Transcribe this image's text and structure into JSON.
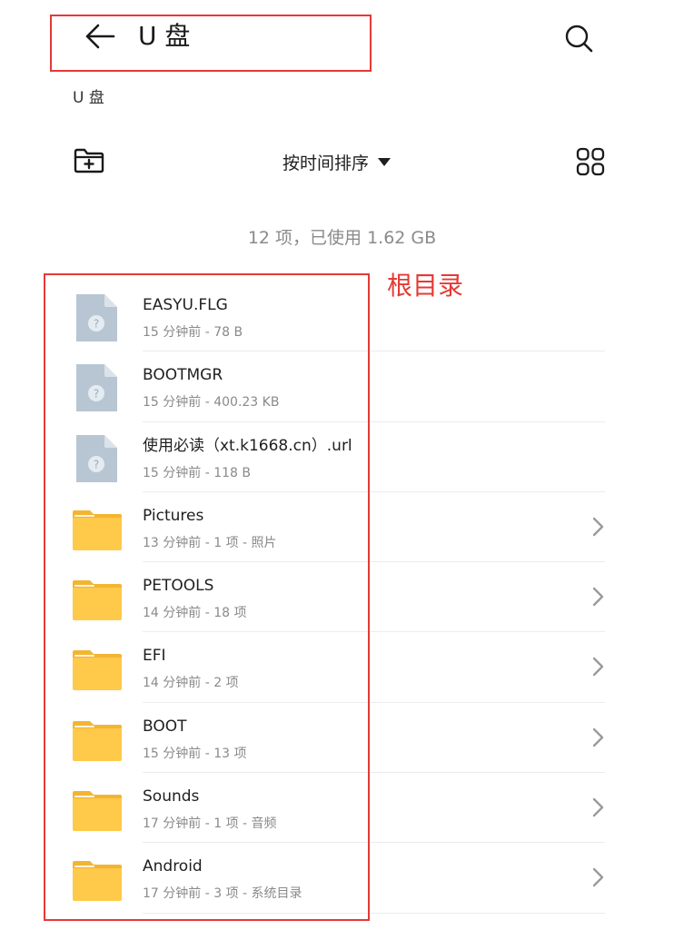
{
  "header": {
    "title": "U 盘",
    "back_icon": "arrow-left-icon",
    "search_icon": "search-icon"
  },
  "breadcrumb": "U 盘",
  "toolbar": {
    "new_folder_icon": "new-folder-icon",
    "sort_label": "按时间排序",
    "view_icon": "grid-view-icon"
  },
  "summary": "12 项，已使用 1.62 GB",
  "annotation": {
    "label": "根目录",
    "color": "#e53935"
  },
  "colors": {
    "folder": "#ffc94a",
    "folder_tab": "#f3b531",
    "file": "#b8c6d3"
  },
  "files": [
    {
      "name": "EASYU.FLG",
      "meta": "15 分钟前 - 78 B",
      "type": "file"
    },
    {
      "name": "BOOTMGR",
      "meta": "15 分钟前 - 400.23 KB",
      "type": "file"
    },
    {
      "name": "使用必读（xt.k1668.cn）.url",
      "meta": "15 分钟前 - 118 B",
      "type": "file"
    },
    {
      "name": "Pictures",
      "meta": "13 分钟前 - 1 项 - 照片",
      "type": "folder"
    },
    {
      "name": "PETOOLS",
      "meta": "14 分钟前 - 18 项",
      "type": "folder"
    },
    {
      "name": "EFI",
      "meta": "14 分钟前 - 2 项",
      "type": "folder"
    },
    {
      "name": "BOOT",
      "meta": "15 分钟前 - 13 项",
      "type": "folder"
    },
    {
      "name": "Sounds",
      "meta": "17 分钟前 - 1 项 - 音频",
      "type": "folder"
    },
    {
      "name": "Android",
      "meta": "17 分钟前 - 3 项 - 系统目录",
      "type": "folder"
    }
  ]
}
